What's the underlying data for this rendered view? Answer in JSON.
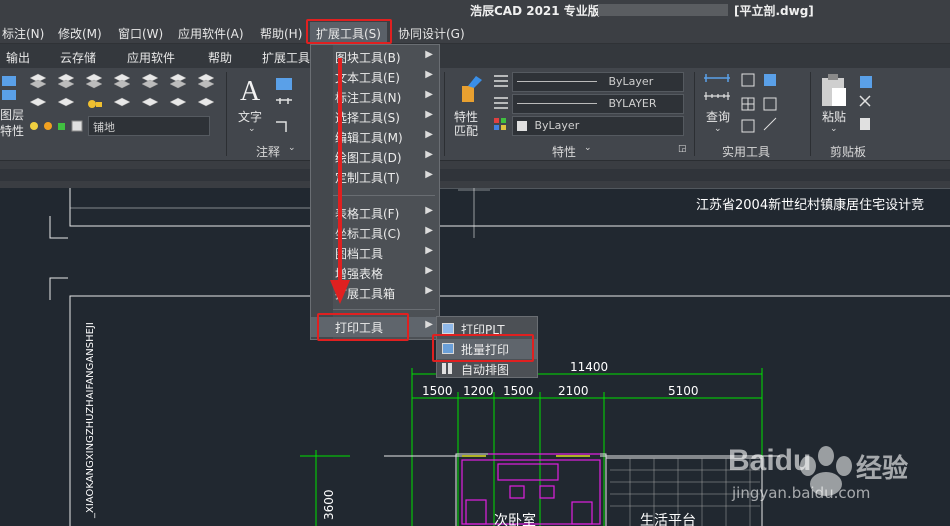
{
  "titlebar": {
    "title": "浩辰CAD 2021 专业版",
    "file": "[平立剖.dwg]"
  },
  "menubar": {
    "items": [
      "标注(N)",
      "修改(M)",
      "窗口(W)",
      "应用软件(A)",
      "帮助(H)",
      "扩展工具(S)",
      "协同设计(G)"
    ]
  },
  "ribbontabs": {
    "items": [
      "输出",
      "云存储",
      "应用软件",
      "帮助",
      "扩展工具"
    ]
  },
  "ribbon": {
    "layer_panel_title": "图层",
    "layer_label_top": "图层",
    "layer_label_bottom": "特性",
    "layer_dropdown": "铺地",
    "annotation_panel_title": "注释",
    "text_label": "文字",
    "properties_panel_title": "特性",
    "match_label_top": "特性",
    "match_label_bottom": "匹配",
    "bylayer_1": "ByLayer",
    "bylayer_2": "BYLAYER",
    "bylayer_3": "ByLayer",
    "utilities_panel_title": "实用工具",
    "query_label": "查询",
    "clipboard_panel_title": "剪贴板",
    "paste_label": "粘贴"
  },
  "extmenu": {
    "items": [
      "图块工具(B)",
      "文本工具(E)",
      "标注工具(N)",
      "选择工具(S)",
      "编辑工具(M)",
      "绘图工具(D)",
      "定制工具(T)",
      "表格工具(F)",
      "坐标工具(C)",
      "图档工具",
      "增强表格",
      "扩展工具箱",
      "打印工具"
    ]
  },
  "printmenu": {
    "items": [
      "打印PLT",
      "批量打印",
      "自动排图"
    ]
  },
  "drawing": {
    "header_text": "江苏省2004新世纪村镇康居住宅设计竞",
    "vertical_text": "_XIAOKANGXINGZHUZHAIFANGANSHEJI",
    "dim_total": "11400",
    "dims": [
      "1500",
      "1200",
      "1500",
      "2100",
      "5100"
    ],
    "dim_vertical": "3600",
    "room_1": "次卧室",
    "room_2": "生活平台"
  },
  "watermark": {
    "brand": "Baidu",
    "brand_cn": "经验",
    "url": "jingyan.baidu.com"
  },
  "colors": {
    "highlight": "#e02020",
    "dim_green": "#00e000",
    "wall_magenta": "#e020e0"
  }
}
